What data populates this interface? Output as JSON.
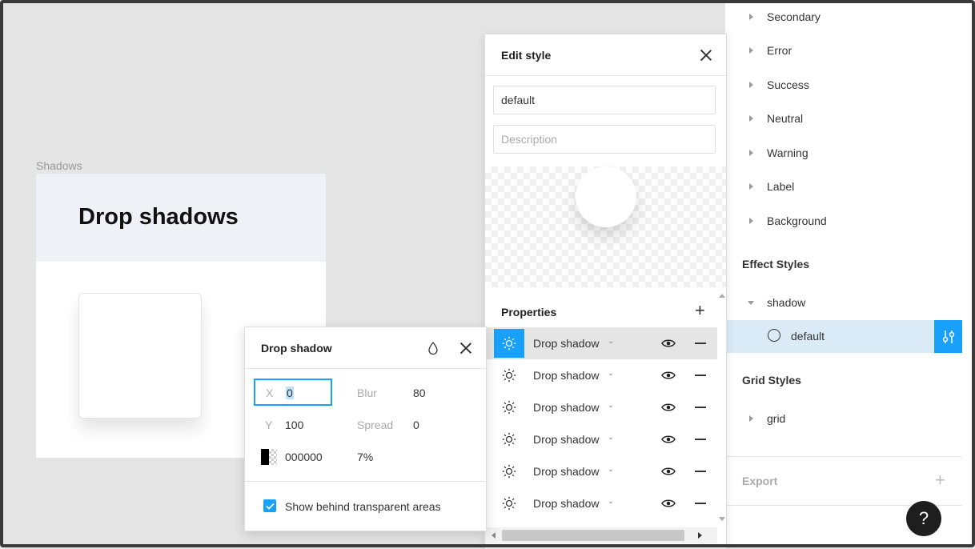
{
  "canvas": {
    "frame_label": "Shadows",
    "frame_title": "Drop shadows"
  },
  "sidebar": {
    "color_groups": [
      "Secondary",
      "Error",
      "Success",
      "Neutral",
      "Warning",
      "Label",
      "Background"
    ],
    "effect_styles_title": "Effect Styles",
    "effect_group": "shadow",
    "effect_style_item": "default",
    "grid_styles_title": "Grid Styles",
    "grid_group": "grid",
    "export_label": "Export",
    "help_label": "?"
  },
  "edit_style": {
    "title": "Edit style",
    "name_value": "default",
    "description_placeholder": "Description",
    "properties_title": "Properties",
    "properties": [
      {
        "label": "Drop shadow",
        "active": true
      },
      {
        "label": "Drop shadow",
        "active": false
      },
      {
        "label": "Drop shadow",
        "active": false
      },
      {
        "label": "Drop shadow",
        "active": false
      },
      {
        "label": "Drop shadow",
        "active": false
      },
      {
        "label": "Drop shadow",
        "active": false
      }
    ]
  },
  "drop_shadow": {
    "title": "Drop shadow",
    "x_label": "X",
    "x_value": "0",
    "y_label": "Y",
    "y_value": "100",
    "blur_label": "Blur",
    "blur_value": "80",
    "spread_label": "Spread",
    "spread_value": "0",
    "color_value": "000000",
    "opacity_value": "7%",
    "checkbox_label": "Show behind transparent areas",
    "checkbox_checked": true
  },
  "colors": {
    "accent": "#18a0fb",
    "selected_row": "#daebf7"
  }
}
